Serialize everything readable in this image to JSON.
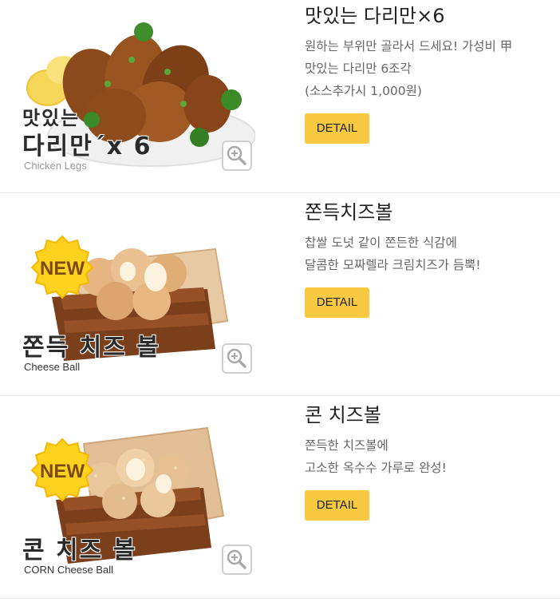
{
  "products": [
    {
      "name": "맛있는 다리만×6",
      "desc_lines": [
        "원하는 부위만 골라서 드세요! 가성비 甲",
        "맛있는 다리만 6조각",
        "(소스추가시 1,000원)"
      ],
      "detail_label": "DETAIL",
      "image": {
        "title_line1": "맛있는",
        "title_line2": "다리만´x 6",
        "subtitle": "Chicken Legs",
        "badge": null
      }
    },
    {
      "name": "쫀득치즈볼",
      "desc_lines": [
        "찹쌀 도넛 같이 쫀든한 식감에",
        "달콤한 모짜렐라 크림치즈가 듬뿍!"
      ],
      "detail_label": "DETAIL",
      "image": {
        "title_line1": "쫀득 치즈 볼",
        "subtitle": "Cheese Ball",
        "badge": "NEW"
      }
    },
    {
      "name": "콘 치즈볼",
      "desc_lines": [
        "쫀득한 치즈볼에",
        "고소한 옥수수 가루로 완성!"
      ],
      "detail_label": "DETAIL",
      "image": {
        "title_line1": "콘 치즈 볼",
        "subtitle": "CORN Cheese Ball",
        "badge": "NEW"
      }
    }
  ],
  "icons": {
    "zoom": "zoom-in-magnifier-icon",
    "badge": "new-badge-icon"
  },
  "colors": {
    "detail_button": "#f9c942",
    "badge_fill": "#ffd21f",
    "badge_text": "#7a4a12",
    "divider": "#e6e6e6"
  }
}
